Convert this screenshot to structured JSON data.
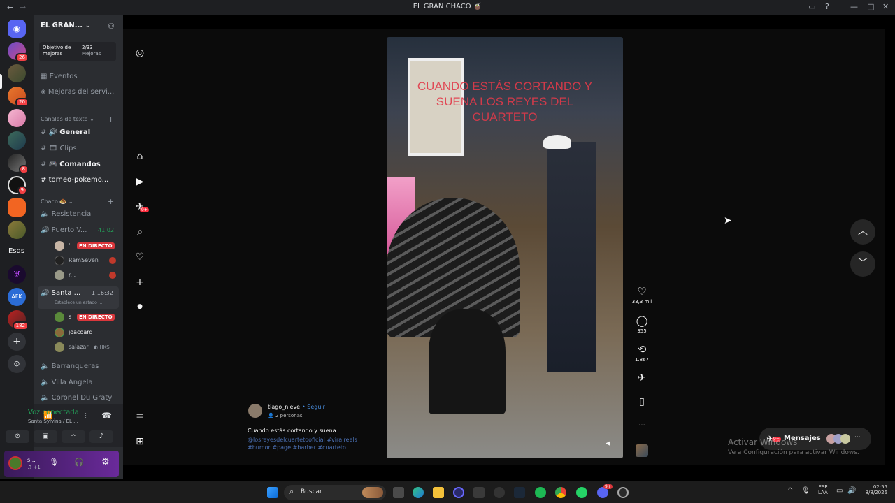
{
  "window": {
    "title": "EL GRAN CHACO 🧉",
    "back": "←",
    "forward": "→"
  },
  "server": {
    "name": "EL GRAN...",
    "boost": {
      "label": "Objetivo de mejoras",
      "count": "2/33",
      "unit": "Mejoras"
    }
  },
  "rail_badges": [
    "26",
    "20",
    "8",
    "9",
    "182"
  ],
  "rail_text_server": "Esds",
  "nav": {
    "events": "Eventos",
    "boosts": "Mejoras del servi..."
  },
  "categories": {
    "text": "Canales de texto",
    "chaco": "Chaco 🧆"
  },
  "text_channels": [
    {
      "name": "General"
    },
    {
      "name": "Clips"
    },
    {
      "name": "Comandos"
    },
    {
      "name": "torneo-pokemo..."
    }
  ],
  "voice": {
    "resistencia": "Resistencia",
    "puerto": {
      "name": "Puerto V...",
      "time": "41:02"
    },
    "puerto_users": [
      "'.",
      "RamSeven",
      "r..."
    ],
    "santa": {
      "name": "Santa ...",
      "time": "1:16:32",
      "status": "Establece un estado ..."
    },
    "santa_users": [
      "ꜱ",
      "joacoard",
      "salazar"
    ],
    "others": [
      "Barranqueras",
      "Villa Angela",
      "Coronel Du Graty"
    ]
  },
  "live_label": "EN DIRECTO",
  "hks_tag": "HKS",
  "voice_status": {
    "title": "Voz conectada",
    "subtitle": "Santa Sylvina / EL ..."
  },
  "user": {
    "name": "s...",
    "sub": "♫ +1"
  },
  "post": {
    "overlay_text": "CUANDO ESTÁS CORTANDO Y SUENA  LOS REYES DEL CUARTETO",
    "author": "tiago_nieve",
    "follow": "• Seguir",
    "people": "2 personas",
    "caption": "Cuando estás cortando y suena",
    "mention": "@losreyesdelcuartetooficial",
    "tags": "#viralreels #humor #page #barber #cuarteto",
    "likes": "33,3 mil",
    "comments": "355",
    "reposts": "1.867",
    "more": "..."
  },
  "ig_notif_badge": "9+",
  "messages": {
    "label": "Mensajes",
    "badge": "9+"
  },
  "activate": {
    "title": "Activar Windows",
    "sub": "Ve a Configuración para activar Windows."
  },
  "taskbar": {
    "search": "Buscar",
    "lang1": "ESP",
    "lang2": "LAA",
    "time": "02:55",
    "date": "8/8/2026",
    "discord_badge": "9+"
  }
}
